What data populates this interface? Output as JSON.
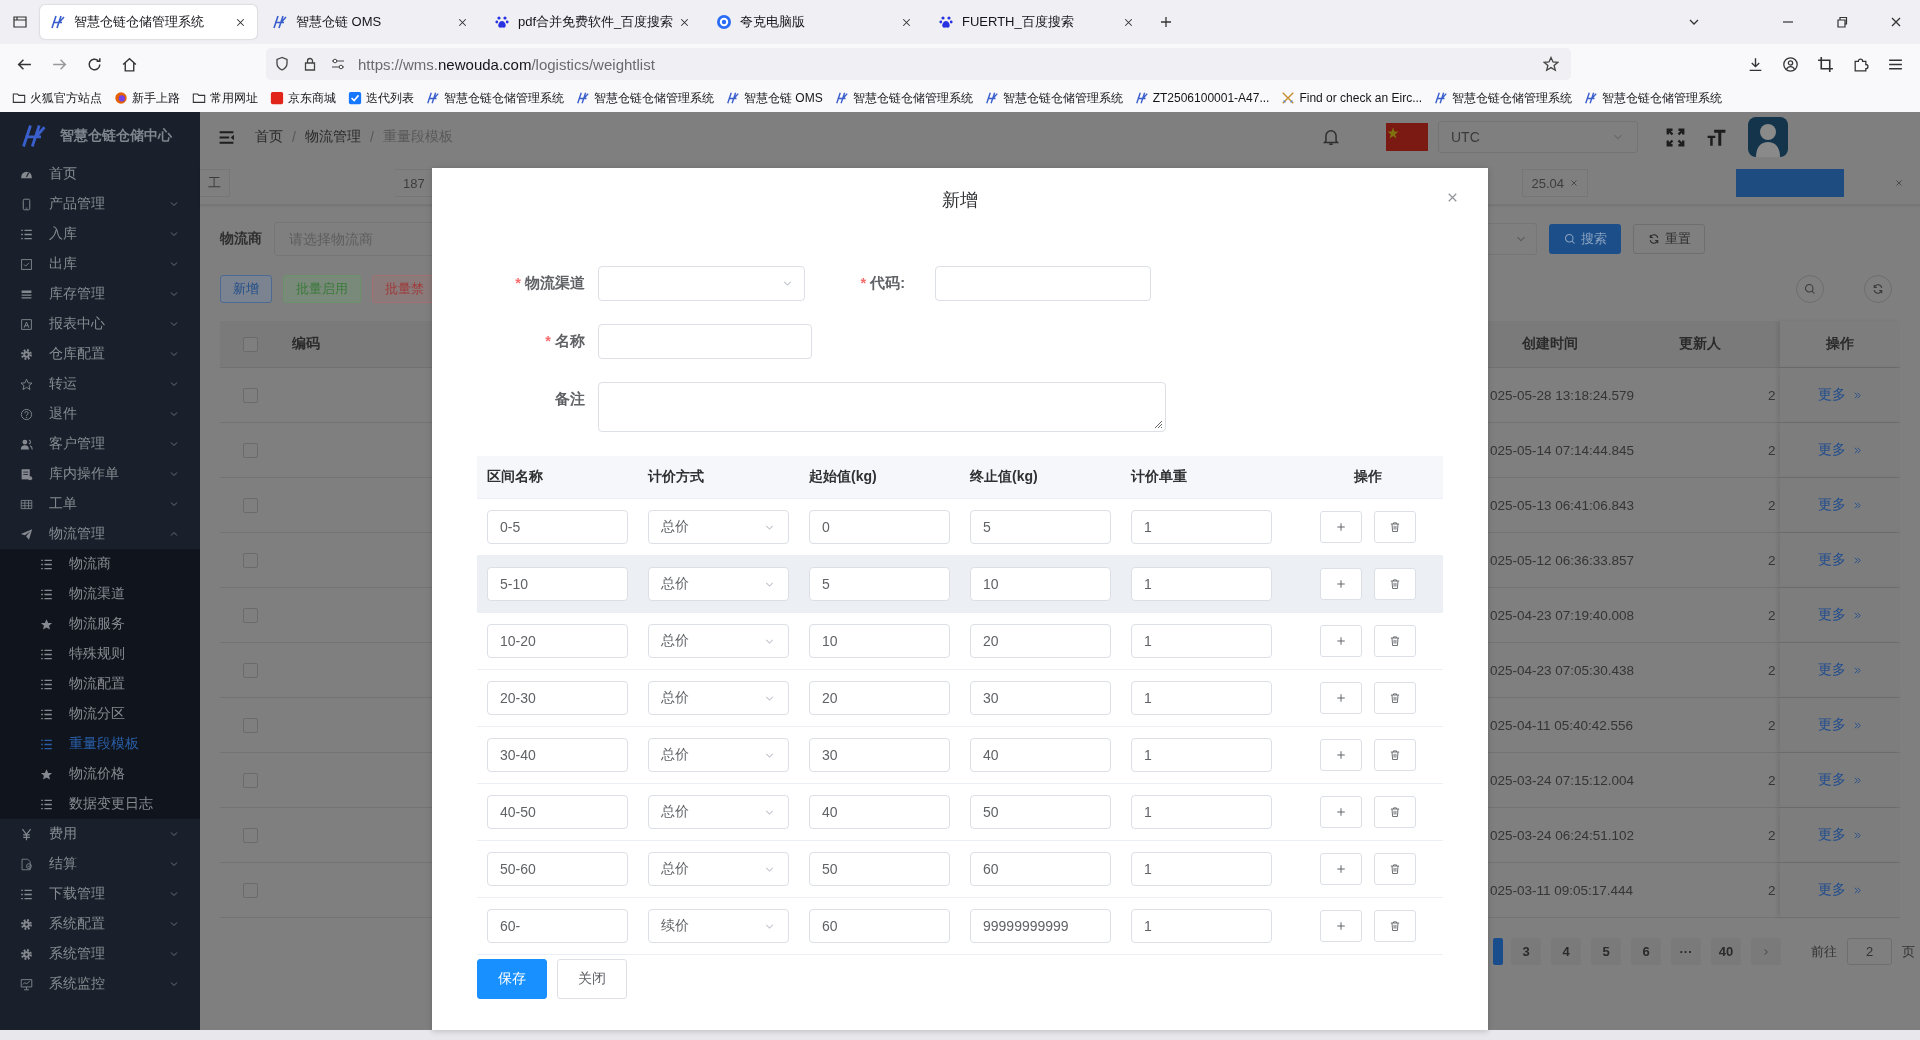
{
  "browser": {
    "tabs": [
      {
        "title": "智慧仓链仓储管理系统",
        "kind": "logo",
        "selected": true
      },
      {
        "title": "智慧仓链 OMS",
        "kind": "logo",
        "selected": false
      },
      {
        "title": "pdf合并免费软件_百度搜索",
        "kind": "paw",
        "selected": false
      },
      {
        "title": "夸克电脑版",
        "kind": "ring",
        "selected": false
      },
      {
        "title": "FUERTH_百度搜索",
        "kind": "paw",
        "selected": false
      }
    ],
    "url": {
      "prefix": "https://wms.",
      "domain": "newouda.com",
      "path": "/logistics/weightlist"
    },
    "bookmarks": [
      {
        "label": "火狐官方站点",
        "kind": "folder"
      },
      {
        "label": "新手上路",
        "kind": "firefox"
      },
      {
        "label": "常用网址",
        "kind": "folder"
      },
      {
        "label": "京东商城",
        "kind": "redsquare"
      },
      {
        "label": "迭代列表",
        "kind": "check"
      },
      {
        "label": "智慧仓链仓储管理系统",
        "kind": "logo"
      },
      {
        "label": "智慧仓链仓储管理系统",
        "kind": "logo"
      },
      {
        "label": "智慧仓链 OMS",
        "kind": "logo"
      },
      {
        "label": "智慧仓链仓储管理系统",
        "kind": "logo"
      },
      {
        "label": "智慧仓链仓储管理系统",
        "kind": "logo"
      },
      {
        "label": "ZT2506100001-A47...",
        "kind": "logo"
      },
      {
        "label": "Find or check an Eirc...",
        "kind": "swords"
      },
      {
        "label": "智慧仓链仓储管理系统",
        "kind": "logo"
      },
      {
        "label": "智慧仓链仓储管理系统",
        "kind": "logo"
      }
    ]
  },
  "app": {
    "logo": "智慧仓链仓储中心",
    "sidebar": [
      {
        "label": "首页",
        "kind": "gauge"
      },
      {
        "label": "产品管理",
        "kind": "phone",
        "expanded": false
      },
      {
        "label": "入库",
        "kind": "list",
        "expanded": false
      },
      {
        "label": "出库",
        "kind": "checkbox",
        "expanded": false
      },
      {
        "label": "库存管理",
        "kind": "stack",
        "expanded": false
      },
      {
        "label": "报表中心",
        "kind": "report",
        "expanded": false
      },
      {
        "label": "仓库配置",
        "kind": "gear",
        "expanded": false
      },
      {
        "label": "转运",
        "kind": "staroutline",
        "expanded": false
      },
      {
        "label": "退件",
        "kind": "question",
        "expanded": false
      },
      {
        "label": "客户管理",
        "kind": "user",
        "expanded": false
      },
      {
        "label": "库内操作单",
        "kind": "doc",
        "expanded": false
      },
      {
        "label": "工单",
        "kind": "table",
        "expanded": false
      },
      {
        "label": "物流管理",
        "kind": "plane",
        "expanded": true,
        "children": [
          {
            "label": "物流商",
            "kind": "list",
            "selected": false
          },
          {
            "label": "物流渠道",
            "kind": "list",
            "selected": false
          },
          {
            "label": "物流服务",
            "kind": "star",
            "selected": false
          },
          {
            "label": "特殊规则",
            "kind": "list",
            "selected": false
          },
          {
            "label": "物流配置",
            "kind": "list",
            "selected": false
          },
          {
            "label": "物流分区",
            "kind": "list",
            "selected": false
          },
          {
            "label": "重量段模板",
            "kind": "list",
            "selected": true
          },
          {
            "label": "物流价格",
            "kind": "star",
            "selected": false
          },
          {
            "label": "数据变更日志",
            "kind": "list",
            "selected": false
          }
        ]
      },
      {
        "label": "费用",
        "kind": "yen",
        "expanded": false
      },
      {
        "label": "结算",
        "kind": "doccheck",
        "expanded": false
      },
      {
        "label": "下载管理",
        "kind": "list",
        "expanded": false
      },
      {
        "label": "系统配置",
        "kind": "gear",
        "expanded": false
      },
      {
        "label": "系统管理",
        "kind": "gear",
        "expanded": false
      },
      {
        "label": "系统监控",
        "kind": "monitor",
        "expanded": false
      }
    ],
    "breadcrumb": [
      {
        "label": "首页"
      },
      {
        "separator": "/",
        "label": "物流管理"
      },
      {
        "separator": "/",
        "label": "重量段模板"
      }
    ],
    "timezone": "UTC",
    "tags": [
      {
        "label": "工",
        "selected": false,
        "closable": false
      },
      {
        "label": "187",
        "selected": false,
        "closable": false
      },
      {
        "label": "25.04",
        "selected": false,
        "closable": true
      },
      {
        "selected": true,
        "closable": false
      },
      {
        "selected": false,
        "closable": true
      }
    ],
    "filter": {
      "label": "物流商",
      "placeholder": "请选择物流商",
      "search_button": "搜索",
      "reset_button": "重置"
    },
    "actions": [
      {
        "label": "新增",
        "kind": "primary"
      },
      {
        "label": "批量启用",
        "kind": "success"
      },
      {
        "label": "批量禁",
        "kind": "danger"
      }
    ],
    "table": {
      "columns": [
        "编码",
        "创建时间",
        "更新人",
        "操作"
      ],
      "header_checked": false,
      "rows": [
        {
          "checked": false,
          "created_at": "025-05-28 13:18:24.579",
          "column_5": "2",
          "action": "更多"
        },
        {
          "checked": false,
          "created_at": "025-05-14 07:14:44.845",
          "column_5": "2",
          "action": "更多"
        },
        {
          "checked": false,
          "created_at": "025-05-13 06:41:06.843",
          "column_5": "2",
          "action": "更多"
        },
        {
          "checked": false,
          "created_at": "025-05-12 06:36:33.857",
          "column_5": "2",
          "action": "更多"
        },
        {
          "checked": false,
          "created_at": "025-04-23 07:19:40.008",
          "column_5": "2",
          "action": "更多"
        },
        {
          "checked": false,
          "created_at": "025-04-23 07:05:30.438",
          "column_5": "2",
          "action": "更多"
        },
        {
          "checked": false,
          "created_at": "025-04-11 05:40:42.556",
          "column_5": "2",
          "action": "更多"
        },
        {
          "checked": false,
          "created_at": "025-03-24 07:15:12.004",
          "column_5": "2",
          "action": "更多"
        },
        {
          "checked": false,
          "created_at": "025-03-24 06:24:51.102",
          "column_5": "2",
          "action": "更多"
        },
        {
          "checked": false,
          "created_at": "025-03-11 09:05:17.444",
          "column_5": "2",
          "action": "更多"
        }
      ]
    },
    "pagination": {
      "pages": [
        {
          "selected": true
        },
        {
          "label": "3",
          "selected": false
        },
        {
          "label": "4",
          "selected": false
        },
        {
          "label": "5",
          "selected": false
        },
        {
          "label": "6",
          "selected": false
        },
        {
          "label": "···",
          "selected": false
        },
        {
          "label": "40",
          "selected": false
        }
      ],
      "goto_label": "前往",
      "goto_value": "2",
      "page_suffix": "页"
    }
  },
  "modal": {
    "title": "新增",
    "form_rows": [
      [
        {
          "label": "物流渠道",
          "required_mark": "*",
          "kind": "select"
        },
        {
          "label": "代码:",
          "required_mark": "*",
          "kind": "input"
        }
      ],
      [
        {
          "label": "名称",
          "required_mark": "*",
          "kind": "input"
        }
      ],
      [
        {
          "label": "备注",
          "kind": "textarea"
        }
      ]
    ],
    "segments": {
      "columns": [
        "区间名称",
        "计价方式",
        "起始值(kg)",
        "终止值(kg)",
        "计价单重",
        "操作"
      ],
      "rows": [
        {
          "name": "0-5",
          "pricing": "总价",
          "start": "0",
          "end": "5",
          "unit_weight": "1",
          "hovered": false
        },
        {
          "name": "5-10",
          "pricing": "总价",
          "start": "5",
          "end": "10",
          "unit_weight": "1",
          "hovered": true
        },
        {
          "name": "10-20",
          "pricing": "总价",
          "start": "10",
          "end": "20",
          "unit_weight": "1",
          "hovered": false
        },
        {
          "name": "20-30",
          "pricing": "总价",
          "start": "20",
          "end": "30",
          "unit_weight": "1",
          "hovered": false
        },
        {
          "name": "30-40",
          "pricing": "总价",
          "start": "30",
          "end": "40",
          "unit_weight": "1",
          "hovered": false
        },
        {
          "name": "40-50",
          "pricing": "总价",
          "start": "40",
          "end": "50",
          "unit_weight": "1",
          "hovered": false
        },
        {
          "name": "50-60",
          "pricing": "总价",
          "start": "50",
          "end": "60",
          "unit_weight": "1",
          "hovered": false
        },
        {
          "name": "60-",
          "pricing": "续价",
          "start": "60",
          "end": "99999999999",
          "unit_weight": "1",
          "hovered": false
        }
      ]
    },
    "buttons": [
      {
        "label": "保存",
        "kind": "primary"
      },
      {
        "label": "关闭",
        "kind": "default"
      }
    ]
  }
}
